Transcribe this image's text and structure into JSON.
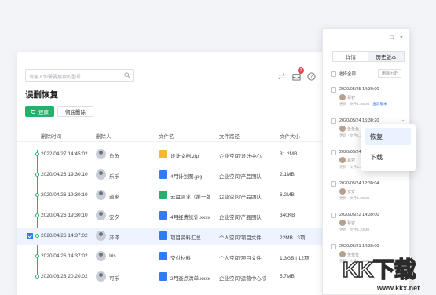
{
  "search": {
    "placeholder": "请输入你需要搜索的型号"
  },
  "header": {
    "notification_count": "2"
  },
  "page": {
    "title": "误删恢复"
  },
  "toolbar": {
    "restore_label": "还原",
    "permanent_delete_label": "彻底删除"
  },
  "table": {
    "columns": [
      "删除时间",
      "删除人",
      "文件名",
      "文件路径",
      "文件大小"
    ],
    "rows": [
      {
        "time": "2022/04/27 14:45:02",
        "user": "鱼鱼",
        "file": "设计文档.zip",
        "path": "企业空间/设计中心",
        "size": "31.2MB",
        "icon_color": "#f5b92d",
        "selected": false
      },
      {
        "time": "2020/04/26 19:30:10",
        "user": "乐乐",
        "file": "4月计划图.jpg",
        "path": "企业空间/产品团队",
        "size": "2.1MB",
        "icon_color": "#2f7cf6",
        "selected": false
      },
      {
        "time": "2020/04/26 19:30:10",
        "user": "道家",
        "file": "云盘需求（第一版）",
        "path": "企业空间/产品团队",
        "size": "6.2MB",
        "icon_color": "#23b26d",
        "selected": false
      },
      {
        "time": "2020/04/26 19:30:10",
        "user": "安夕",
        "file": "4月经费统计.xxxx",
        "path": "企业空间/产品团队",
        "size": "340KB",
        "icon_color": "#2f7cf6",
        "selected": false
      },
      {
        "time": "2020/04/26 14:37:02",
        "user": "泽泽",
        "file": "项目资料汇总",
        "path": "个人空间/项目文件",
        "size": "22MB | 3项",
        "icon_color": "#2f7cf6",
        "selected": true
      },
      {
        "time": "2020/04/26 14:37:02",
        "user": "Iris",
        "file": "交付材料",
        "path": "个人空间/项目文件",
        "size": "1.3GB | 12项",
        "icon_color": "#2f7cf6",
        "selected": false
      },
      {
        "time": "2020/03/28 20:20:02",
        "user": "可乐",
        "file": "2月查点清单.xxxx",
        "path": "企业空间/运营中心/资源",
        "size": "5.7MB",
        "icon_color": "#2f7cf6",
        "selected": false
      }
    ]
  },
  "panel": {
    "window_controls": [
      "—",
      "□",
      "×"
    ],
    "tabs": [
      "详情",
      "历史版本"
    ],
    "active_tab": 1,
    "select_all_label": "选择全部",
    "delete_history_label": "删除历史",
    "versions": [
      {
        "time": "2020/05/25 14:30:00",
        "name": "慕容",
        "desc": "更新 · 文件1.33MB",
        "link": "当前版本"
      },
      {
        "time": "2020/05/24 15:30:20",
        "name": "鱼鱼鱼",
        "desc": "更新 · 文件1.23MB",
        "link": ""
      },
      {
        "time": "2020/05/24 14:30:00",
        "name": "慕容",
        "desc": "更新 · 文件1.33MB",
        "link": ""
      },
      {
        "time": "2020/05/24 12:30:04",
        "name": "安安",
        "desc": "更新 · 文件1.33MB",
        "link": ""
      },
      {
        "time": "2020/05/22 14:30:00",
        "name": "慕容",
        "desc": "更新 · 文件1.33MB",
        "link": ""
      },
      {
        "time": "2020/05/21 14:30:00",
        "name": "鱼鱼鱼",
        "desc": "更新 · 文件1.33MB",
        "link": ""
      }
    ]
  },
  "context_menu": {
    "items": [
      "恢复",
      "下载"
    ]
  },
  "watermark": {
    "text": "KK下载",
    "url": "www.kkx.net"
  }
}
